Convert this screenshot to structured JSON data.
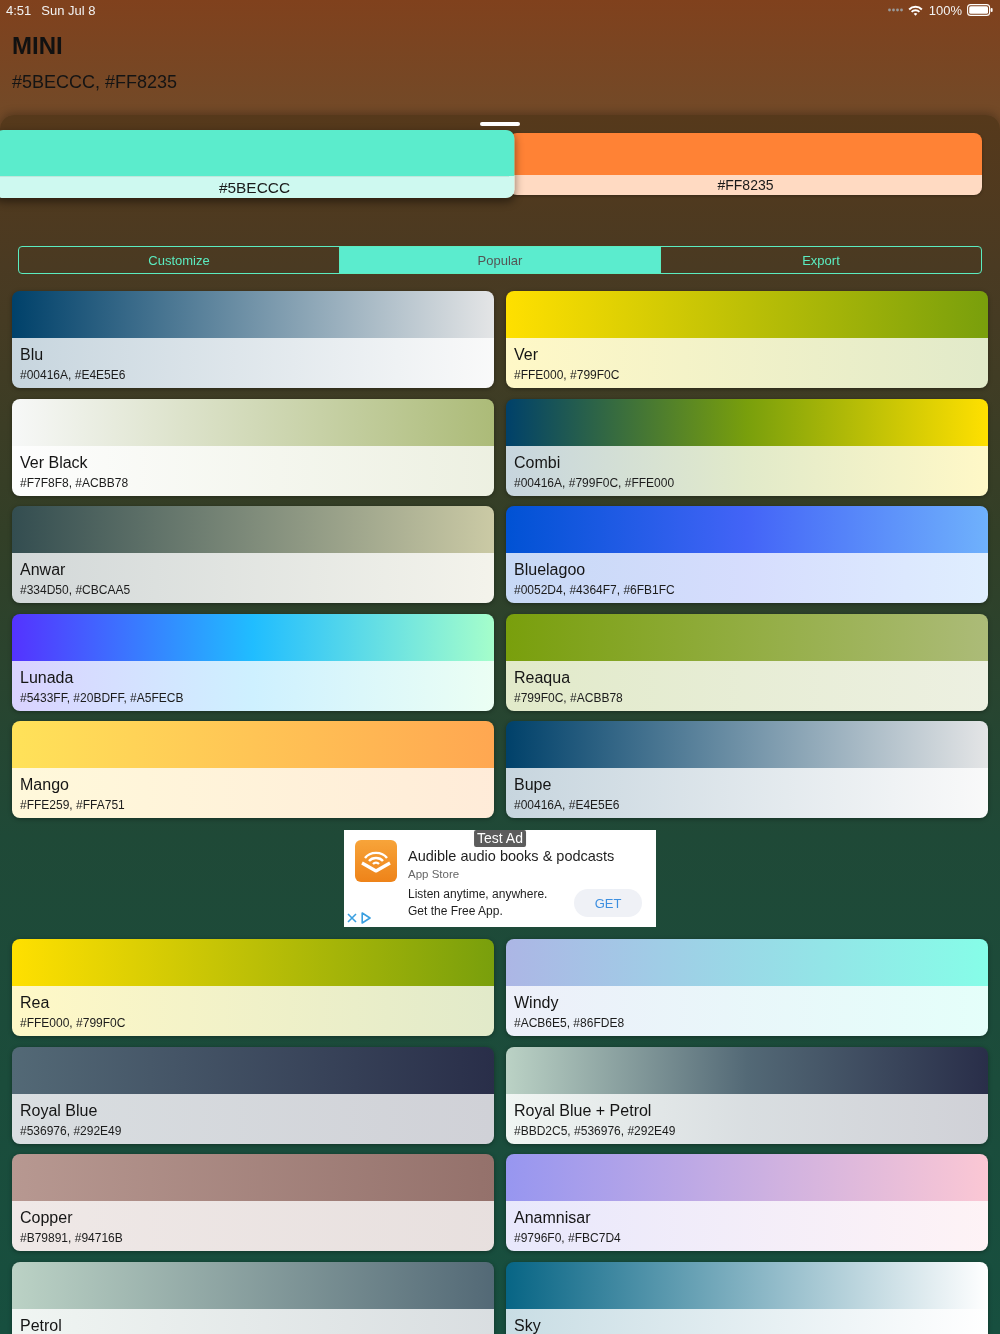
{
  "status_bar": {
    "time": "4:51",
    "date": "Sun Jul 8",
    "battery": "100%"
  },
  "header": {
    "title": "MINI",
    "subtitle": "#5BECCC, #FF8235"
  },
  "swatches": [
    {
      "color": "#5BECCC",
      "label": "#5BECCC",
      "selected": true
    },
    {
      "color": "#FF8235",
      "label": "#FF8235",
      "selected": false
    }
  ],
  "tabs": [
    {
      "label": "Customize",
      "selected": false
    },
    {
      "label": "Popular",
      "selected": true
    },
    {
      "label": "Export",
      "selected": false
    }
  ],
  "gradients": [
    {
      "name": "Blu",
      "codes": "#00416A, #E4E5E6",
      "stops": [
        {
          "color": "#00416A"
        },
        {
          "color": "#E4E5E6"
        }
      ]
    },
    {
      "name": "Ver",
      "codes": "#FFE000, #799F0C",
      "stops": [
        {
          "color": "#FFE000"
        },
        {
          "color": "#799F0C"
        }
      ]
    },
    {
      "name": "Ver Black",
      "codes": "#F7F8F8, #ACBB78",
      "stops": [
        {
          "color": "#F7F8F8"
        },
        {
          "color": "#ACBB78"
        }
      ]
    },
    {
      "name": "Combi",
      "codes": "#00416A, #799F0C, #FFE000",
      "stops": [
        {
          "color": "#00416A"
        },
        {
          "color": "#799F0C"
        },
        {
          "color": "#FFE000"
        }
      ]
    },
    {
      "name": "Anwar",
      "codes": "#334D50, #CBCAA5",
      "stops": [
        {
          "color": "#334D50"
        },
        {
          "color": "#CBCAA5"
        }
      ]
    },
    {
      "name": "Bluelagoo",
      "codes": "#0052D4, #4364F7, #6FB1FC",
      "stops": [
        {
          "color": "#0052D4"
        },
        {
          "color": "#4364F7"
        },
        {
          "color": "#6FB1FC"
        }
      ]
    },
    {
      "name": "Lunada",
      "codes": "#5433FF, #20BDFF, #A5FECB",
      "stops": [
        {
          "color": "#5433FF"
        },
        {
          "color": "#20BDFF"
        },
        {
          "color": "#A5FECB"
        }
      ]
    },
    {
      "name": "Reaqua",
      "codes": "#799F0C, #ACBB78",
      "stops": [
        {
          "color": "#799F0C"
        },
        {
          "color": "#ACBB78"
        }
      ]
    },
    {
      "name": "Mango",
      "codes": "#FFE259, #FFA751",
      "stops": [
        {
          "color": "#FFE259"
        },
        {
          "color": "#FFA751"
        }
      ]
    },
    {
      "name": "Bupe",
      "codes": "#00416A, #E4E5E6",
      "stops": [
        {
          "color": "#00416A"
        },
        {
          "color": "#E4E5E6"
        }
      ]
    }
  ],
  "ad": {
    "label": "Test Ad",
    "title": "Audible audio books & podcasts",
    "store": "App Store",
    "description_lines": [
      "Listen anytime, anywhere.",
      "Get the Free App."
    ],
    "button": "GET"
  },
  "more_gradients": [
    {
      "name": "Rea",
      "codes": "#FFE000, #799F0C",
      "stops": [
        {
          "color": "#FFE000"
        },
        {
          "color": "#799F0C"
        }
      ]
    },
    {
      "name": "Windy",
      "codes": "#ACB6E5, #86FDE8",
      "stops": [
        {
          "color": "#ACB6E5"
        },
        {
          "color": "#86FDE8"
        }
      ]
    },
    {
      "name": "Royal Blue",
      "codes": "#536976, #292E49",
      "stops": [
        {
          "color": "#536976"
        },
        {
          "color": "#292E49"
        }
      ]
    },
    {
      "name": "Royal Blue + Petrol",
      "codes": "#BBD2C5, #536976, #292E49",
      "stops": [
        {
          "color": "#BBD2C5"
        },
        {
          "color": "#536976"
        },
        {
          "color": "#292E49"
        }
      ]
    },
    {
      "name": "Copper",
      "codes": "#B79891, #94716B",
      "stops": [
        {
          "color": "#B79891"
        },
        {
          "color": "#94716B"
        }
      ]
    },
    {
      "name": "Anamnisar",
      "codes": "#9796F0, #FBC7D4",
      "stops": [
        {
          "color": "#9796F0"
        },
        {
          "color": "#FBC7D4"
        }
      ]
    },
    {
      "name": "Petrol",
      "stops": [
        {
          "color": "#BBD2C5"
        },
        {
          "color": "#536976"
        }
      ]
    },
    {
      "name": "Sky",
      "stops": [
        {
          "color": "#076585"
        },
        {
          "color": "#FFFFFF"
        }
      ]
    }
  ]
}
